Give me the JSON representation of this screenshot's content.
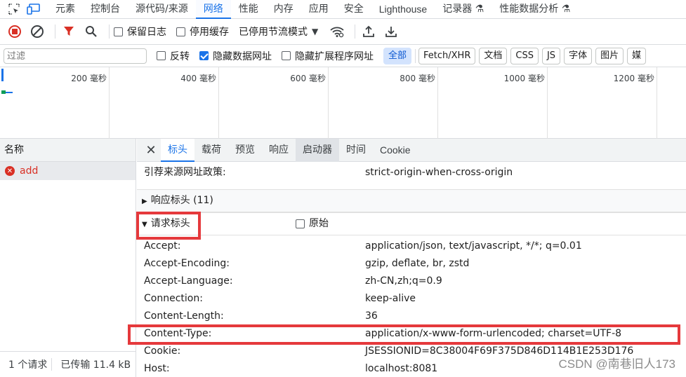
{
  "top_tabs": [
    "元素",
    "控制台",
    "源代码/来源",
    "网络",
    "性能",
    "内存",
    "应用",
    "安全",
    "Lighthouse",
    "记录器 ⚗",
    "性能数据分析 ⚗"
  ],
  "toolbar": {
    "preserve_log": "保留日志",
    "disable_cache": "停用缓存",
    "throttling": "已停用节流模式"
  },
  "filter": {
    "placeholder": "过滤",
    "invert": "反转",
    "hide_data_urls": "隐藏数据网址",
    "hide_extension_urls": "隐藏扩展程序网址",
    "types": [
      "全部",
      "Fetch/XHR",
      "文档",
      "CSS",
      "JS",
      "字体",
      "图片",
      "媒"
    ]
  },
  "overview": {
    "ticks": [
      "200 毫秒",
      "400 毫秒",
      "600 毫秒",
      "800 毫秒",
      "1000 毫秒",
      "1200 毫秒"
    ]
  },
  "left": {
    "header": "名称",
    "request_name": "add",
    "footer_requests": "1 个请求",
    "footer_transferred": "已传输 11.4 kB"
  },
  "detail": {
    "tabs": [
      "标头",
      "载荷",
      "预览",
      "响应",
      "启动器",
      "时间",
      "Cookie"
    ],
    "referrer_key": "引荐来源网址政策:",
    "referrer_value": "strict-origin-when-cross-origin",
    "response_headers": "响应标头 (11)",
    "request_headers": "请求标头",
    "raw_label": "原始",
    "request_header_rows": [
      {
        "k": "Accept:",
        "v": "application/json, text/javascript, */*; q=0.01"
      },
      {
        "k": "Accept-Encoding:",
        "v": "gzip, deflate, br, zstd"
      },
      {
        "k": "Accept-Language:",
        "v": "zh-CN,zh;q=0.9"
      },
      {
        "k": "Connection:",
        "v": "keep-alive"
      },
      {
        "k": "Content-Length:",
        "v": "36"
      },
      {
        "k": "Content-Type:",
        "v": "application/x-www-form-urlencoded; charset=UTF-8"
      },
      {
        "k": "Cookie:",
        "v": "JSESSIONID=8C38004F69F375D846D114B1E253D176"
      },
      {
        "k": "Host:",
        "v": "localhost:8081"
      }
    ]
  },
  "watermark": "CSDN @南巷旧人173",
  "colors": {
    "accent": "#1a73e8",
    "error": "#d93025",
    "highlight_box": "#e5393c"
  }
}
